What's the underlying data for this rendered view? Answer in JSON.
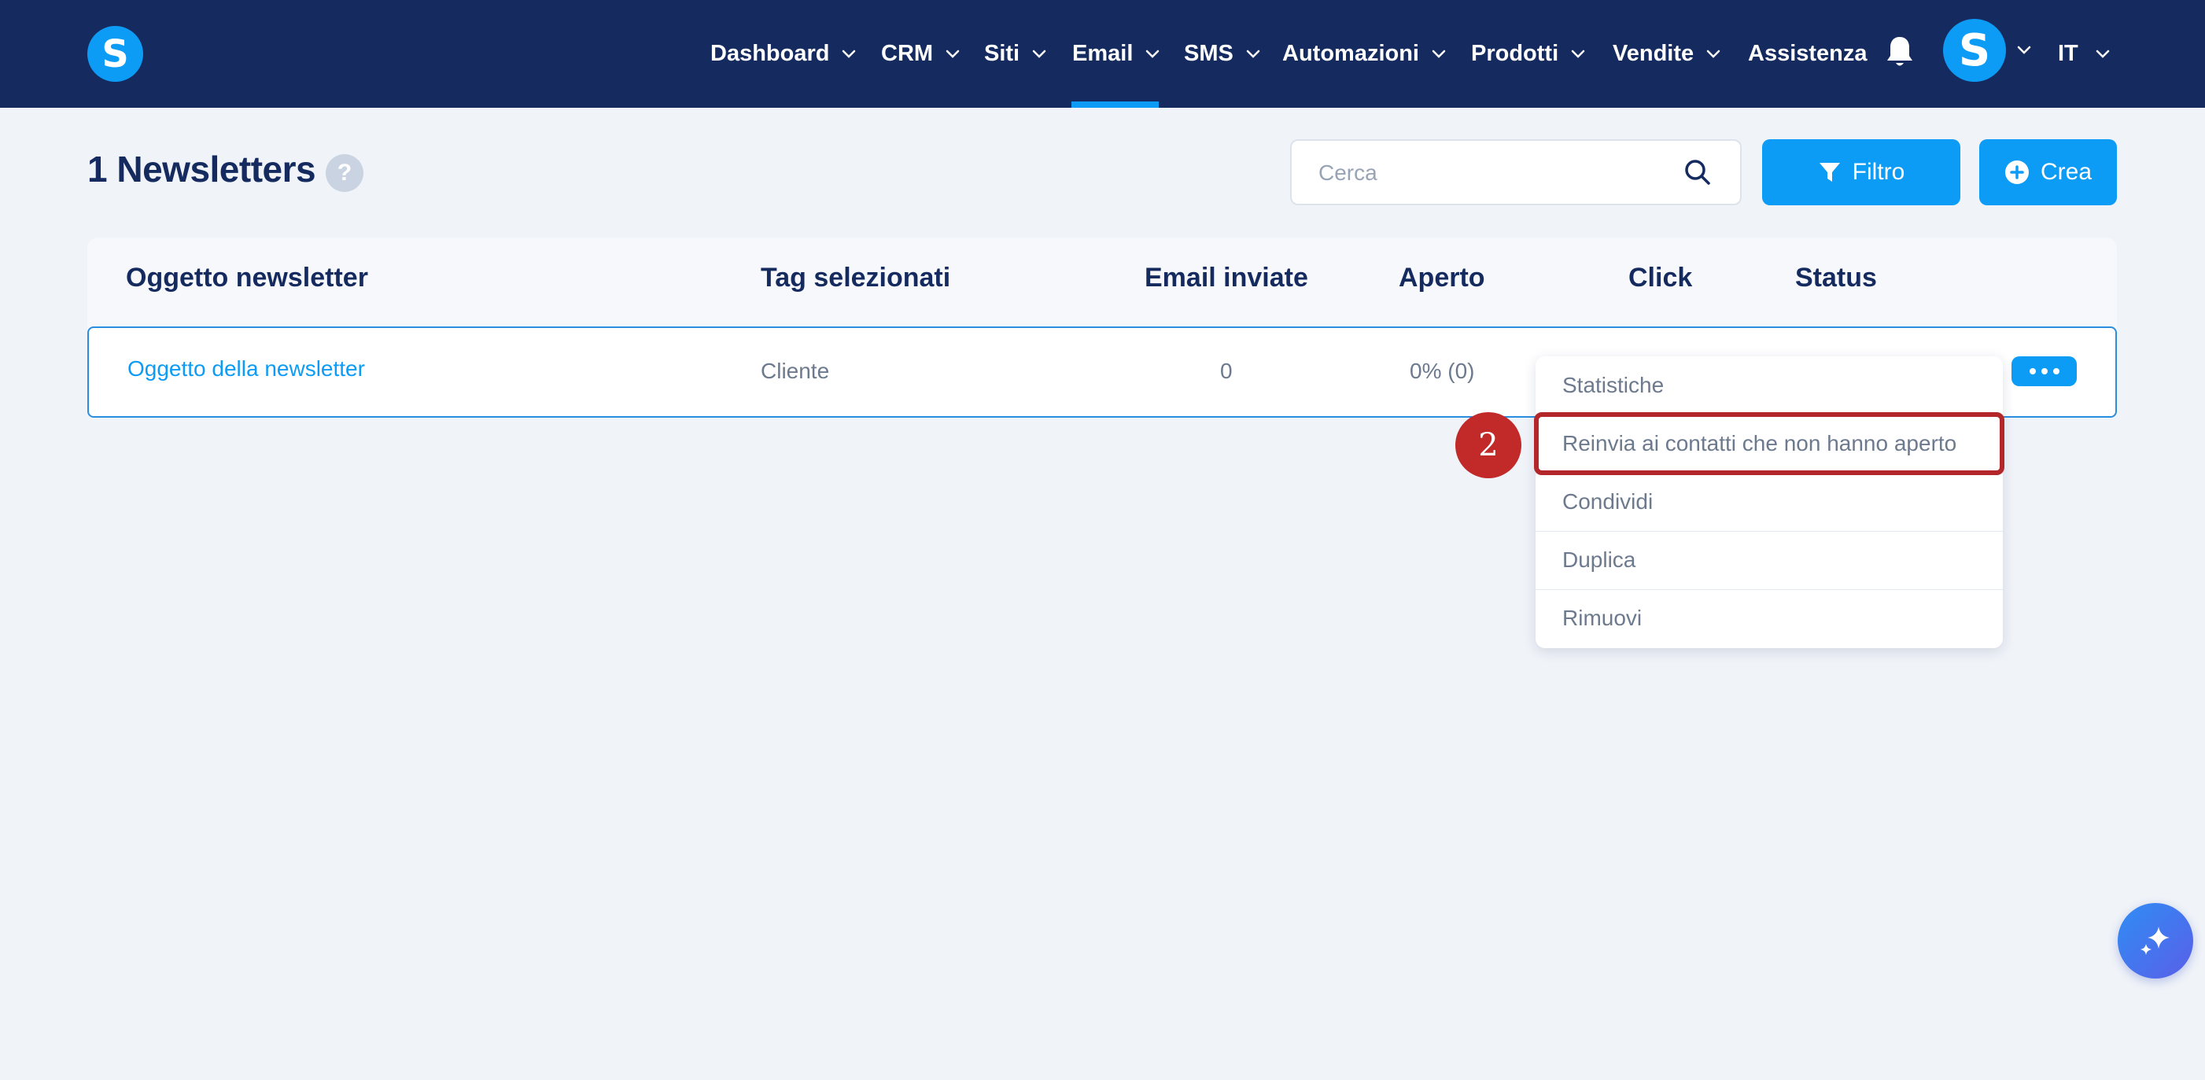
{
  "app": {
    "logo_letter": "S",
    "brand_color": "#0d9cf5",
    "nav_bg": "#152b5f"
  },
  "nav": {
    "items": [
      {
        "label": "Dashboard",
        "has_dropdown": true
      },
      {
        "label": "CRM",
        "has_dropdown": true
      },
      {
        "label": "Siti",
        "has_dropdown": true
      },
      {
        "label": "Email",
        "has_dropdown": true,
        "active": true
      },
      {
        "label": "SMS",
        "has_dropdown": true
      },
      {
        "label": "Automazioni",
        "has_dropdown": true
      },
      {
        "label": "Prodotti",
        "has_dropdown": true
      },
      {
        "label": "Vendite",
        "has_dropdown": true
      },
      {
        "label": "Assistenza",
        "has_dropdown": false
      }
    ],
    "notifications_icon": "bell-icon",
    "avatar_letter": "S",
    "language": "IT"
  },
  "header": {
    "title": "1 Newsletters",
    "help_label": "?",
    "search_placeholder": "Cerca",
    "filter_label": "Filtro",
    "create_label": "Crea"
  },
  "table": {
    "columns": [
      "Oggetto newsletter",
      "Tag selezionati",
      "Email inviate",
      "Aperto",
      "Click",
      "Status"
    ],
    "rows": [
      {
        "subject": "Oggetto della newsletter",
        "tags": "Cliente",
        "sent": "0",
        "opened": "0% (0)"
      }
    ]
  },
  "menu": {
    "items": [
      "Statistiche",
      "Reinvia ai contatti che non hanno aperto",
      "Condividi",
      "Duplica",
      "Rimuovi"
    ],
    "highlighted_index": 1
  },
  "annotation": {
    "step": "2",
    "color": "#c22a2a"
  }
}
